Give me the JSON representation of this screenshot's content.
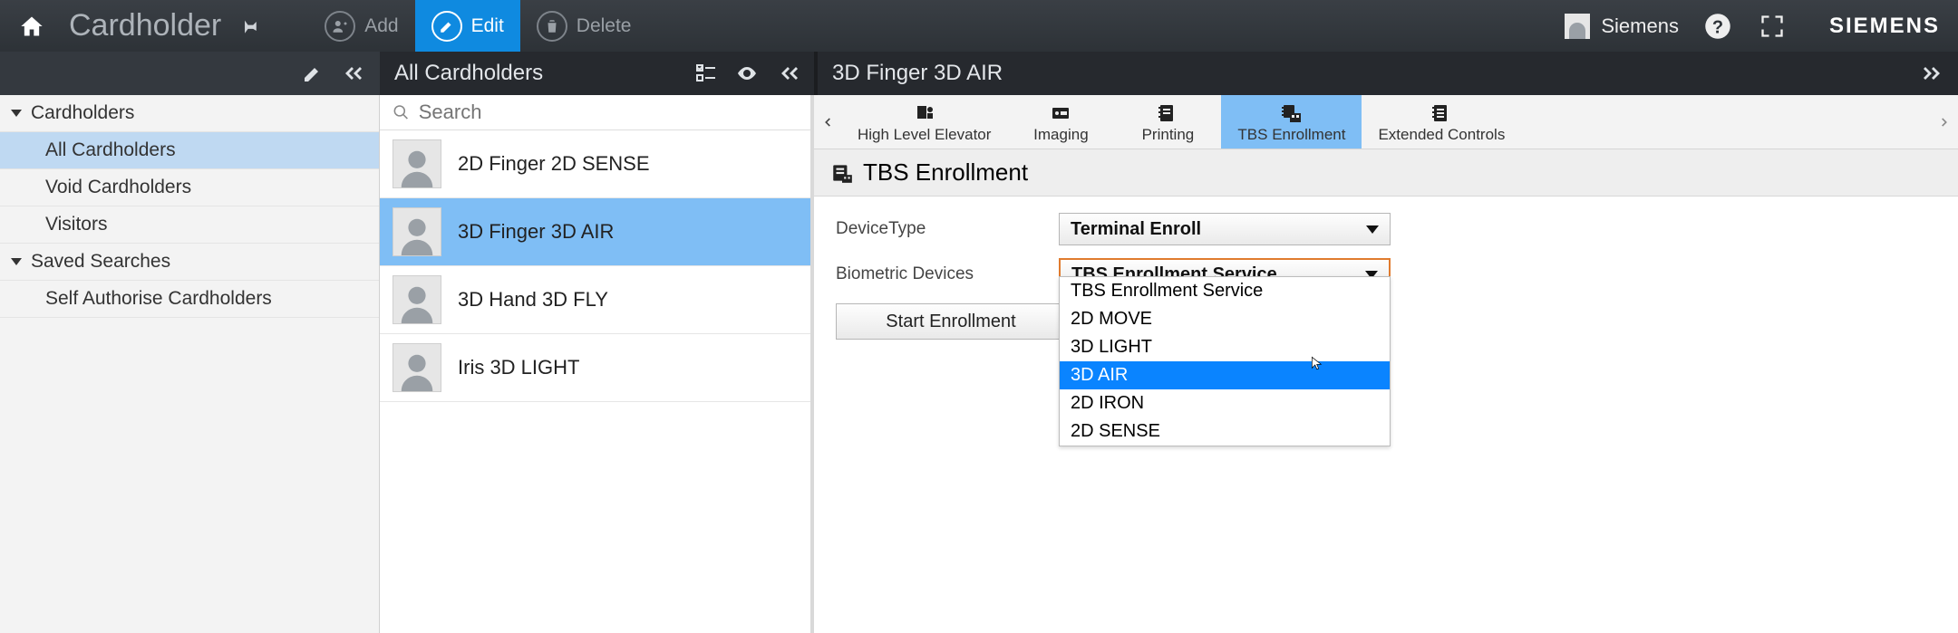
{
  "topbar": {
    "title": "Cardholder",
    "add_label": "Add",
    "edit_label": "Edit",
    "delete_label": "Delete",
    "user_name": "Siemens",
    "brand": "SIEMENS"
  },
  "subheader": {
    "middle_title": "All Cardholders",
    "detail_title": "3D Finger 3D AIR"
  },
  "nav": {
    "group1_label": "Cardholders",
    "items1": [
      "All Cardholders",
      "Void Cardholders",
      "Visitors"
    ],
    "group2_label": "Saved Searches",
    "items2": [
      "Self Authorise Cardholders"
    ],
    "selected_index": 0
  },
  "list": {
    "search_placeholder": "Search",
    "rows": [
      "2D Finger 2D SENSE",
      "3D Finger 3D AIR",
      "3D Hand 3D FLY",
      "Iris 3D LIGHT"
    ],
    "selected_index": 1
  },
  "tabs": {
    "items": [
      "High Level Elevator",
      "Imaging",
      "Printing",
      "TBS Enrollment",
      "Extended Controls"
    ],
    "active_index": 3
  },
  "section": {
    "title": "TBS Enrollment"
  },
  "form": {
    "device_type_label": "DeviceType",
    "device_type_value": "Terminal Enroll",
    "biometric_label": "Biometric Devices",
    "biometric_value": "TBS Enrollment Service",
    "start_label": "Start Enrollment"
  },
  "dropdown": {
    "options": [
      "TBS Enrollment Service",
      "2D MOVE",
      "3D LIGHT",
      "3D AIR",
      "2D IRON",
      "2D SENSE"
    ],
    "highlight_index": 3
  }
}
